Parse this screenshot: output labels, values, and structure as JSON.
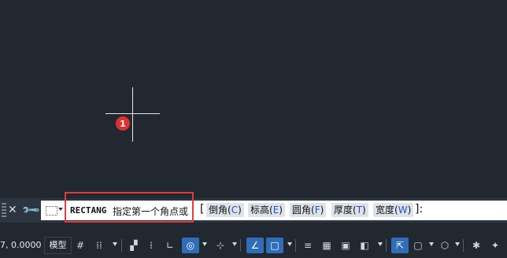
{
  "canvas": {
    "marker_number": "1"
  },
  "command_line": {
    "close_icon": "close-icon",
    "command_name": "RECTANG",
    "prompt": "指定第一个角点或",
    "open_bracket": "[",
    "options": [
      {
        "label": "倒角(",
        "key": "C",
        "end": ")"
      },
      {
        "label": "标高(",
        "key": "E",
        "end": ")"
      },
      {
        "label": "圆角(",
        "key": "F",
        "end": ")"
      },
      {
        "label": "厚度(",
        "key": "T",
        "end": ")"
      },
      {
        "label": "宽度(",
        "key": "W",
        "end": ")"
      }
    ],
    "close_bracket": "]:"
  },
  "status_bar": {
    "coordinates": "7, 0.0000",
    "model_tab": "模型"
  },
  "colors": {
    "canvas_bg": "#212830",
    "highlight_border": "#e23b3b",
    "active_toggle": "#2f6db8",
    "option_key": "#1d55c9"
  }
}
